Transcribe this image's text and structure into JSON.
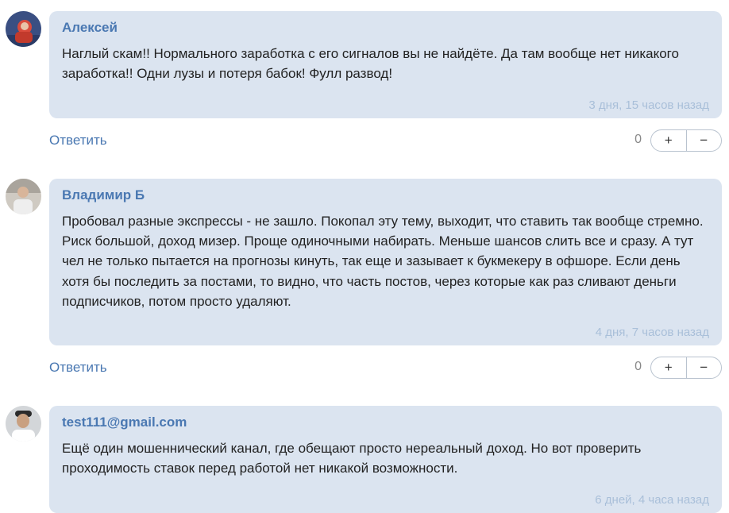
{
  "comments": [
    {
      "author": "Алексей",
      "text": "Наглый скам!! Нормального заработка с его сигналов вы не найдёте. Да там вообще нет никакого заработка!! Одни лузы и потеря бабок! Фулл развод!",
      "time": "3 дня, 15 часов назад",
      "reply_label": "Ответить",
      "score": "0",
      "plus": "+",
      "minus": "−",
      "avatar_color": "#3a4f82"
    },
    {
      "author": "Владимир Б",
      "text": "Пробовал разные экспрессы - не зашло. Покопал эту тему, выходит, что ставить так вообще стремно. Риск большой, доход мизер. Проще одиночными набирать. Меньше шансов слить все и сразу. А тут чел не только пытается на прогнозы кинуть, так еще и зазывает к букмекеру в офшоре. Если день хотя бы последить за постами, то видно, что часть постов, через которые как раз сливают деньги подписчиков, потом просто удаляют.",
      "time": "4 дня, 7 часов назад",
      "reply_label": "Ответить",
      "score": "0",
      "plus": "+",
      "minus": "−",
      "avatar_color": "#c9c4bd"
    },
    {
      "author": "test111@gmail.com",
      "text": "Ещё один мошеннический канал, где обещают просто нереальный доход. Но вот проверить проходимость ставок перед работой нет никакой возможности.",
      "time": "6 дней, 4 часа назад",
      "avatar_color": "#cfd3d6"
    }
  ],
  "colors": {
    "bubble_bg": "#dbe4f0",
    "author": "#4a78b2",
    "timestamp": "#a9bfd9"
  }
}
